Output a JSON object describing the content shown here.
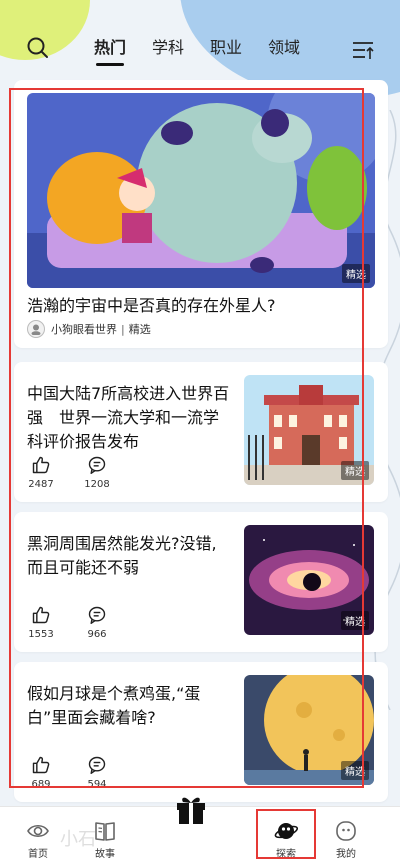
{
  "header": {
    "tabs": [
      {
        "label": "热门",
        "active": true
      },
      {
        "label": "学科",
        "active": false
      },
      {
        "label": "职业",
        "active": false
      },
      {
        "label": "领域",
        "active": false
      }
    ]
  },
  "featured": {
    "title": "浩瀚的宇宙中是否真的存在外星人?",
    "badge": "精选",
    "author": "小狗眼看世界",
    "author_tag": "精选"
  },
  "articles": [
    {
      "title": "中国大陆7所高校进入世界百强　世界一流大学和一流学科评价报告发布",
      "likes": "2487",
      "comments": "1208",
      "badge": "精选"
    },
    {
      "title": "黑洞周围居然能发光?没错,而且可能还不弱",
      "likes": "1553",
      "comments": "966",
      "badge": "精选"
    },
    {
      "title": "假如月球是个煮鸡蛋,“蛋白”里面会藏着啥?",
      "likes": "689",
      "comments": "594",
      "badge": "精选"
    }
  ],
  "bottom_nav": {
    "items": [
      {
        "label": "首页"
      },
      {
        "label": "故事"
      },
      {
        "label": "探索"
      },
      {
        "label": "我的"
      }
    ],
    "watermark": "小石"
  }
}
